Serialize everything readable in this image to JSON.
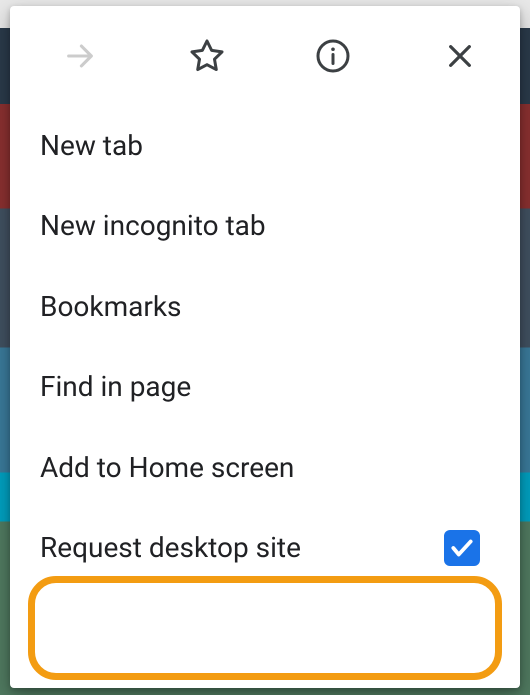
{
  "iconRow": {
    "forward": "forward",
    "star": "star",
    "info": "info",
    "close": "close"
  },
  "menu": {
    "items": [
      {
        "label": "New tab",
        "name": "menu-new-tab"
      },
      {
        "label": "New incognito tab",
        "name": "menu-new-incognito-tab"
      },
      {
        "label": "Bookmarks",
        "name": "menu-bookmarks"
      },
      {
        "label": "Find in page",
        "name": "menu-find-in-page"
      },
      {
        "label": "Add to Home screen",
        "name": "menu-add-to-home-screen"
      },
      {
        "label": "Request desktop site",
        "name": "menu-request-desktop-site",
        "checked": true,
        "highlighted": true
      }
    ]
  },
  "colors": {
    "highlight": "#f39c12",
    "checkbox": "#1a73e8"
  }
}
